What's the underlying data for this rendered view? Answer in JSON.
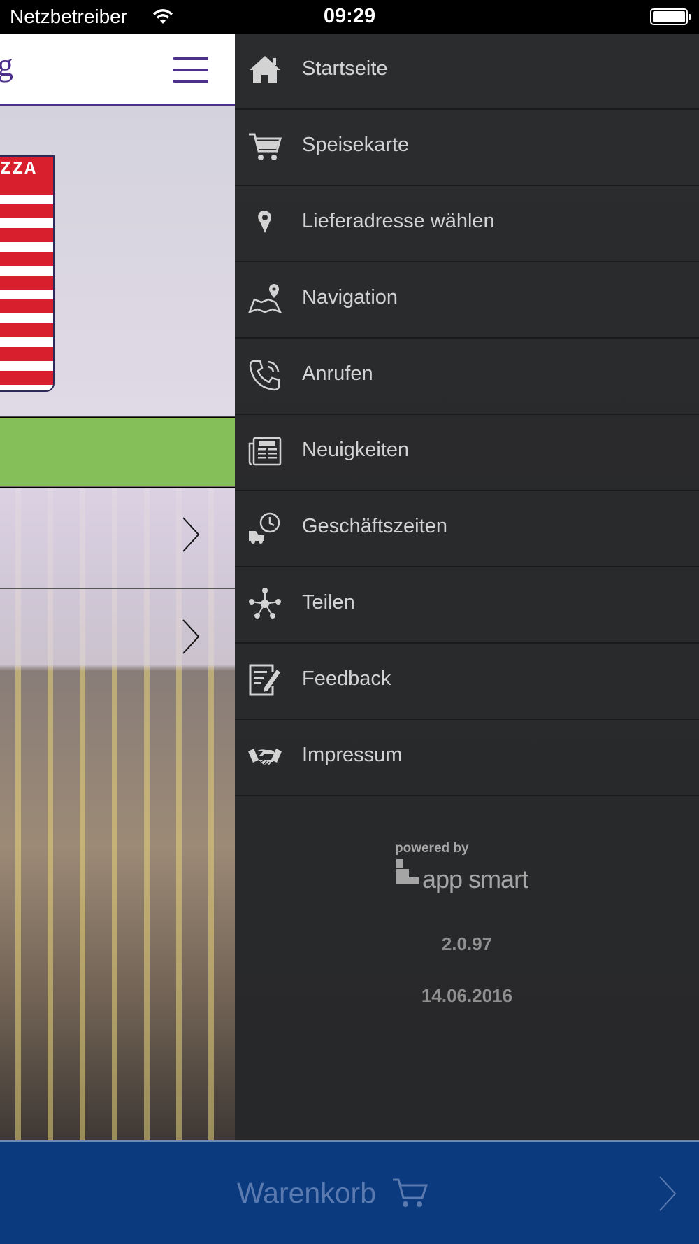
{
  "status_bar": {
    "carrier": "Netzbetreiber",
    "time": "09:29"
  },
  "app_header": {
    "title_fragment": "g"
  },
  "hero": {
    "pizza_box_text": "ZZA"
  },
  "menu": {
    "items": [
      {
        "label": "Startseite",
        "icon": "home-icon"
      },
      {
        "label": "Speisekarte",
        "icon": "cart-icon"
      },
      {
        "label": "Lieferadresse wählen",
        "icon": "location-pin-icon"
      },
      {
        "label": "Navigation",
        "icon": "map-icon"
      },
      {
        "label": "Anrufen",
        "icon": "phone-icon"
      },
      {
        "label": "Neuigkeiten",
        "icon": "newspaper-icon"
      },
      {
        "label": "Geschäftszeiten",
        "icon": "delivery-clock-icon"
      },
      {
        "label": "Teilen",
        "icon": "share-icon"
      },
      {
        "label": "Feedback",
        "icon": "feedback-icon"
      },
      {
        "label": "Impressum",
        "icon": "handshake-icon"
      }
    ],
    "powered_by": "powered by",
    "brand": "app smart",
    "version": "2.0.97",
    "date": "14.06.2016"
  },
  "cart_bar": {
    "label": "Warenkorb"
  },
  "colors": {
    "brand_purple": "#4d2f8c",
    "menu_bg": "#2b2c2e",
    "menu_text": "#d3d3d3",
    "green_bar": "#85bf5a",
    "cart_bar": "#0b3a7e"
  }
}
